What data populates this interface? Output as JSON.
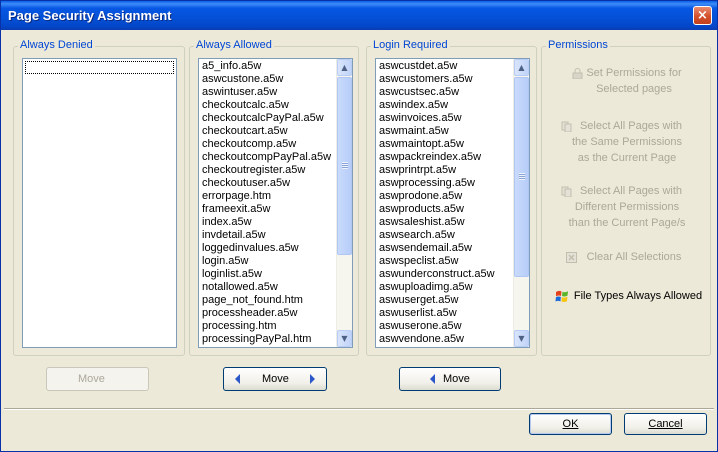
{
  "window": {
    "title": "Page Security Assignment",
    "close_label": "×"
  },
  "groups": {
    "denied": {
      "legend": "Always Denied",
      "items": []
    },
    "allowed": {
      "legend": "Always Allowed",
      "items": [
        "a5_info.a5w",
        "aswcustone.a5w",
        "aswintuser.a5w",
        "checkoutcalc.a5w",
        "checkoutcalcPayPal.a5w",
        "checkoutcart.a5w",
        "checkoutcomp.a5w",
        "checkoutcompPayPal.a5w",
        "checkoutregister.a5w",
        "checkoutuser.a5w",
        "errorpage.htm",
        "frameexit.a5w",
        "index.a5w",
        "invdetail.a5w",
        "loggedinvalues.a5w",
        "login.a5w",
        "loginlist.a5w",
        "notallowed.a5w",
        "page_not_found.htm",
        "processheader.a5w",
        "processing.htm",
        "processingPayPal.htm"
      ]
    },
    "login": {
      "legend": "Login Required",
      "items": [
        "aswcustdet.a5w",
        "aswcustomers.a5w",
        "aswcustsec.a5w",
        "aswindex.a5w",
        "aswinvoices.a5w",
        "aswmaint.a5w",
        "aswmaintopt.a5w",
        "aswpackreindex.a5w",
        "aswprintrpt.a5w",
        "aswprocessing.a5w",
        "aswprodone.a5w",
        "aswproducts.a5w",
        "aswsaleshist.a5w",
        "aswsearch.a5w",
        "aswsendemail.a5w",
        "aswspeclist.a5w",
        "aswunderconstruct.a5w",
        "aswuploadimg.a5w",
        "aswuserget.a5w",
        "aswuserlist.a5w",
        "aswuserone.a5w",
        "aswvendone.a5w"
      ]
    },
    "permissions": {
      "legend": "Permissions",
      "set_permissions": [
        "Set Permissions for",
        "Selected pages"
      ],
      "select_same": [
        "Select All Pages with",
        "the Same Permissions",
        "as the Current Page"
      ],
      "select_different": [
        "Select All Pages with",
        "Different Permissions",
        "than the Current Page/s"
      ],
      "clear_all": "Clear All Selections",
      "file_types": "File Types Always Allowed"
    }
  },
  "buttons": {
    "move_denied": "Move",
    "move_allowed": "Move",
    "move_login": "Move",
    "ok": "OK",
    "cancel": "Cancel"
  },
  "colors": {
    "titlebar": "#0757e4",
    "legend": "#0046d5",
    "disabled_text": "#aca899"
  }
}
